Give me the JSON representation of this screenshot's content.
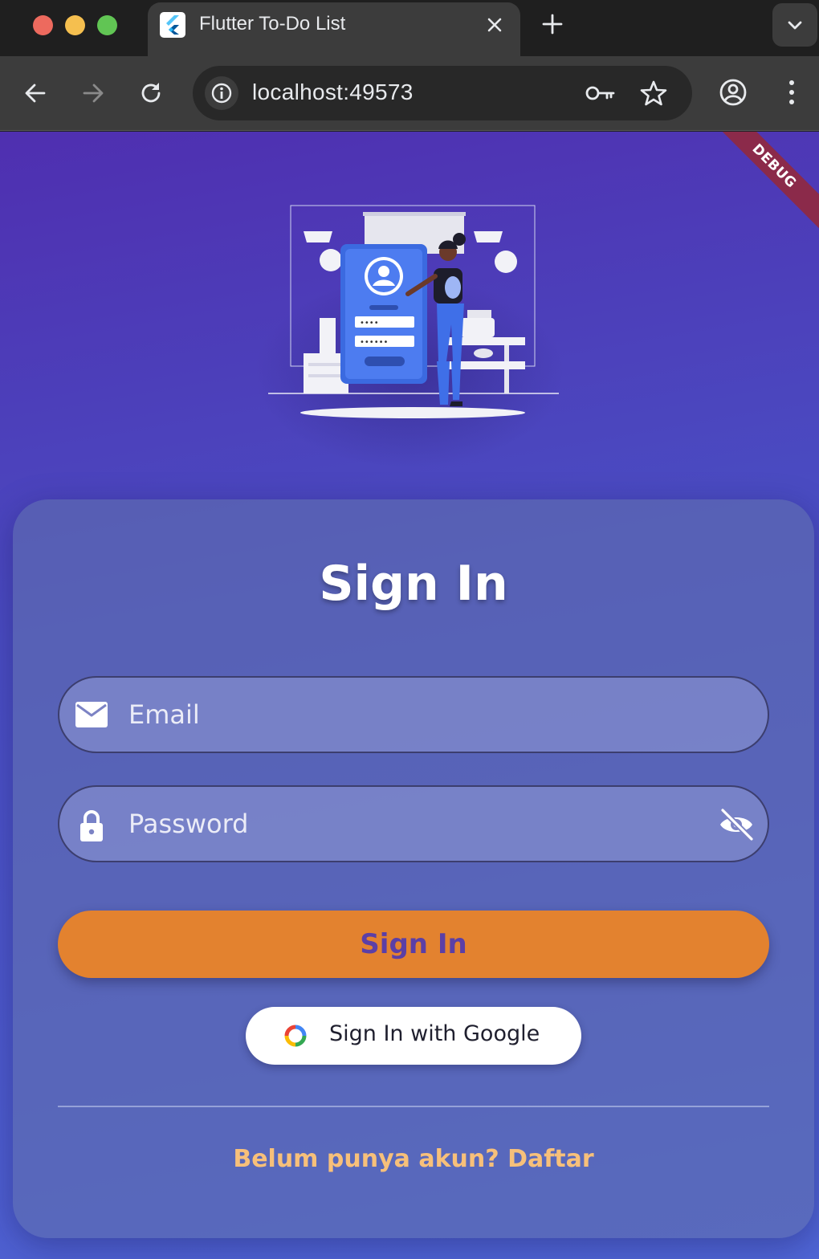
{
  "browser": {
    "tab_title": "Flutter To-Do List",
    "url": "localhost:49573",
    "debug_banner": "DEBUG"
  },
  "login": {
    "title": "Sign In",
    "email_placeholder": "Email",
    "password_placeholder": "Password",
    "signin_label": "Sign In",
    "google_label": "Sign In with Google",
    "register_text": "Belum punya akun? Daftar"
  },
  "colors": {
    "accent": "#e3822f",
    "link": "#f7c07a",
    "background_start": "#4f2fb0",
    "background_end": "#4f65d5"
  },
  "icons": [
    "flutter-icon",
    "close-icon",
    "plus-icon",
    "chevron-down-icon",
    "back-arrow-icon",
    "forward-arrow-icon",
    "reload-icon",
    "info-icon",
    "key-icon",
    "star-icon",
    "profile-icon",
    "more-vert-icon",
    "mail-icon",
    "lock-icon",
    "visibility-off-icon",
    "google-icon"
  ]
}
